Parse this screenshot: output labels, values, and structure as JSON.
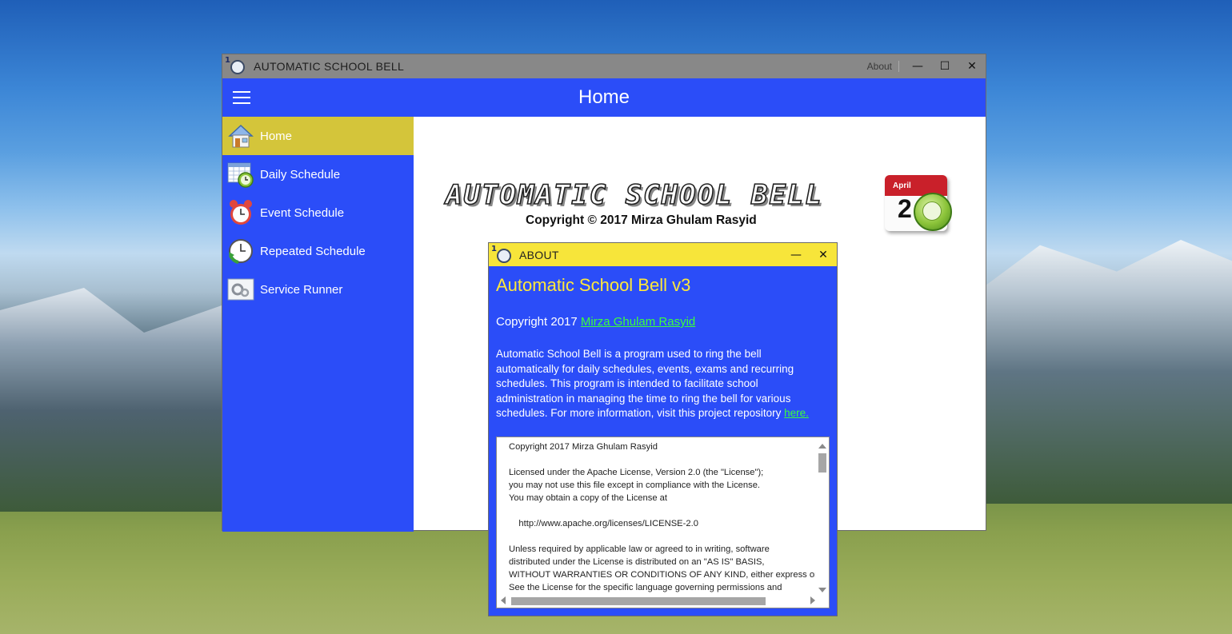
{
  "main_window": {
    "title": "AUTOMATIC SCHOOL BELL",
    "about_label": "About",
    "minimize_glyph": "—",
    "maximize_glyph": "☐",
    "close_glyph": "✕"
  },
  "header": {
    "title": "Home"
  },
  "sidebar": {
    "items": [
      {
        "label": "Home",
        "icon": "house-icon",
        "active": true
      },
      {
        "label": "Daily Schedule",
        "icon": "calendar-clock-icon",
        "active": false
      },
      {
        "label": "Event Schedule",
        "icon": "alarm-clock-icon",
        "active": false
      },
      {
        "label": "Repeated Schedule",
        "icon": "repeat-clock-icon",
        "active": false
      },
      {
        "label": "Service Runner",
        "icon": "service-gear-icon",
        "active": false
      }
    ]
  },
  "home": {
    "banner_title": "AUTOMATIC SCHOOL BELL",
    "copyright": "Copyright © 2017 Mirza Ghulam Rasyid",
    "calendar_month": "April",
    "calendar_day": "2"
  },
  "about_dialog": {
    "title": "ABOUT",
    "heading": "Automatic School Bell v3",
    "copyright_prefix": "Copyright 2017 ",
    "author_link": "Mirza Ghulam Rasyid",
    "description": "Automatic School Bell is a program used to ring the bell automatically for daily schedules, events, exams and recurring schedules. This program is intended to facilitate school administration in managing the time to ring the bell for various schedules. For more information, visit this project repository ",
    "repo_link": "here.",
    "license_text": "Copyright 2017 Mirza Ghulam Rasyid\n\nLicensed under the Apache License, Version 2.0 (the \"License\");\nyou may not use this file except in compliance with the License.\nYou may obtain a copy of the License at\n\n    http://www.apache.org/licenses/LICENSE-2.0\n\nUnless required by applicable law or agreed to in writing, software\ndistributed under the License is distributed on an \"AS IS\" BASIS,\nWITHOUT WARRANTIES OR CONDITIONS OF ANY KIND, either express or implied.\nSee the License for the specific language governing permissions and\nlimitations under the License.",
    "minimize_glyph": "—",
    "close_glyph": "✕"
  },
  "colors": {
    "accent_blue": "#2b4df8",
    "active_item": "#d4c53a",
    "about_title_bg": "#f7e53a",
    "heading_yellow": "#ffe83a",
    "link_green": "#3cff3c"
  }
}
